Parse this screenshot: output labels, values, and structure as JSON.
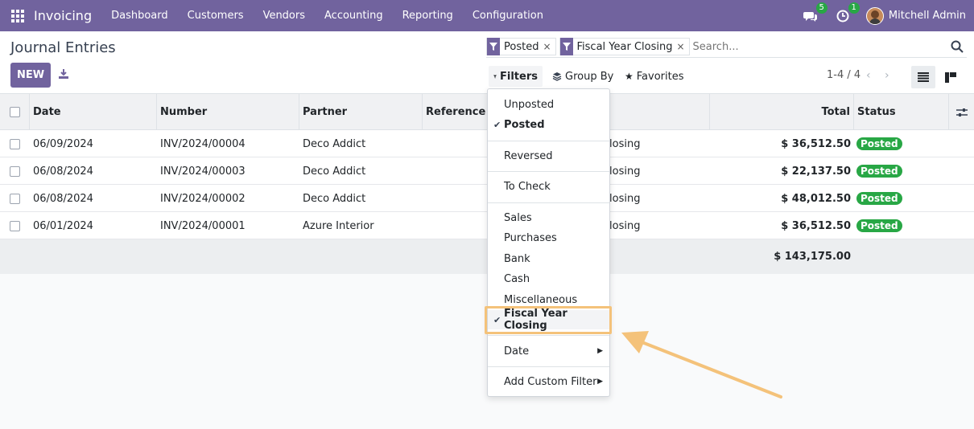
{
  "app": {
    "name": "Invoicing"
  },
  "nav": {
    "menu": [
      "Dashboard",
      "Customers",
      "Vendors",
      "Accounting",
      "Reporting",
      "Configuration"
    ],
    "messages_count": "5",
    "activities_count": "1",
    "user_name": "Mitchell Admin"
  },
  "page": {
    "title": "Journal Entries",
    "new_label": "NEW"
  },
  "search": {
    "facets": [
      "Posted",
      "Fiscal Year Closing"
    ],
    "placeholder": "Search..."
  },
  "controls": {
    "filters_label": "Filters",
    "groupby_label": "Group By",
    "favorites_label": "Favorites",
    "pager": "1-4 / 4"
  },
  "table": {
    "headers": [
      "Date",
      "Number",
      "Partner",
      "Reference",
      "Total",
      "Status"
    ],
    "rows": [
      {
        "date": "06/09/2024",
        "number": "INV/2024/00004",
        "partner": "Deco Addict",
        "journal": "losing",
        "total": "$ 36,512.50",
        "status": "Posted"
      },
      {
        "date": "06/08/2024",
        "number": "INV/2024/00003",
        "partner": "Deco Addict",
        "journal": "losing",
        "total": "$ 22,137.50",
        "status": "Posted"
      },
      {
        "date": "06/08/2024",
        "number": "INV/2024/00002",
        "partner": "Deco Addict",
        "journal": "losing",
        "total": "$ 48,012.50",
        "status": "Posted"
      },
      {
        "date": "06/01/2024",
        "number": "INV/2024/00001",
        "partner": "Azure Interior",
        "journal": "losing",
        "total": "$ 36,512.50",
        "status": "Posted"
      }
    ],
    "grand_total": "$ 143,175.00"
  },
  "filters_menu": {
    "items": [
      {
        "label": "Unposted",
        "checked": false
      },
      {
        "label": "Posted",
        "checked": true
      },
      {
        "label": "Reversed",
        "checked": false
      },
      {
        "label": "To Check",
        "checked": false
      },
      {
        "label": "Sales",
        "checked": false
      },
      {
        "label": "Purchases",
        "checked": false
      },
      {
        "label": "Bank",
        "checked": false
      },
      {
        "label": "Cash",
        "checked": false
      },
      {
        "label": "Miscellaneous",
        "checked": false
      },
      {
        "label": "Fiscal Year Closing",
        "checked": true
      },
      {
        "label": "Date",
        "checked": false
      },
      {
        "label": "Add Custom Filter",
        "checked": false
      }
    ]
  },
  "colors": {
    "brand": "#71639e",
    "success": "#28a745",
    "highlight": "#f4c27a"
  }
}
